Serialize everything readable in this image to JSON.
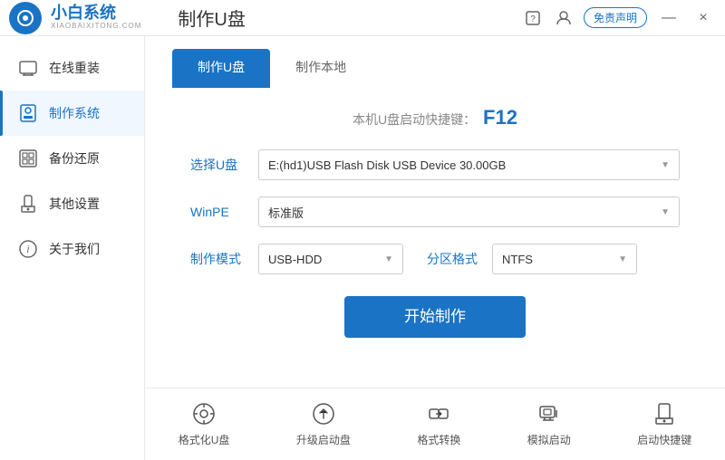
{
  "app": {
    "logo_main": "小白系统",
    "logo_sub": "XIAOBAIXITONG.COM",
    "mianfei_label": "免责声明",
    "page_title": "制作U盘"
  },
  "titlebar": {
    "minimize_label": "—",
    "close_label": "×"
  },
  "sidebar": {
    "items": [
      {
        "id": "online-reinstall",
        "label": "在线重装",
        "icon": "🖥"
      },
      {
        "id": "make-system",
        "label": "制作系统",
        "icon": "💾"
      },
      {
        "id": "backup-restore",
        "label": "备份还原",
        "icon": "📋"
      },
      {
        "id": "other-settings",
        "label": "其他设置",
        "icon": "🔒"
      },
      {
        "id": "about-us",
        "label": "关于我们",
        "icon": "ℹ"
      }
    ],
    "active_item": "make-system"
  },
  "tabs": [
    {
      "id": "make-udisk",
      "label": "制作U盘"
    },
    {
      "id": "make-local",
      "label": "制作本地"
    }
  ],
  "active_tab": "make-udisk",
  "form": {
    "shortcut_prefix": "本机U盘启动快捷键：",
    "shortcut_key": "F12",
    "usb_label": "选择U盘",
    "usb_value": "E:(hd1)USB Flash Disk USB Device 30.00GB",
    "winpe_label": "WinPE",
    "winpe_value": "标准版",
    "mode_label": "制作模式",
    "mode_value": "USB-HDD",
    "partition_label": "分区格式",
    "partition_value": "NTFS",
    "start_btn": "开始制作"
  },
  "bottom_tools": [
    {
      "id": "format-udisk",
      "label": "格式化U盘",
      "icon": "⊙"
    },
    {
      "id": "upgrade-boot",
      "label": "升级启动盘",
      "icon": "⊕"
    },
    {
      "id": "format-convert",
      "label": "格式转换",
      "icon": "⇄"
    },
    {
      "id": "simulate-boot",
      "label": "模拟启动",
      "icon": "⊞"
    },
    {
      "id": "boot-shortcut",
      "label": "启动快捷键",
      "icon": "🔒"
    }
  ]
}
